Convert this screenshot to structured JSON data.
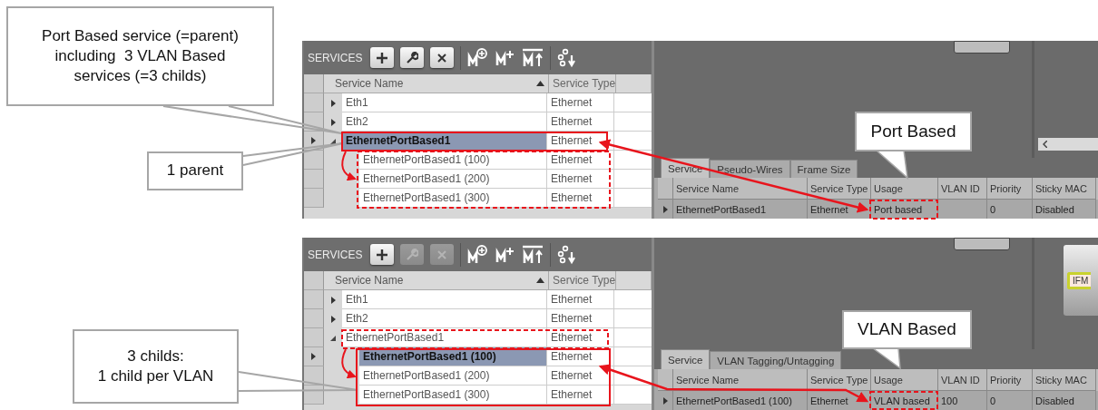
{
  "callouts": [
    {
      "text": "Port Based service (=parent)\nincluding  3 VLAN Based\nservices (=3 childs)"
    },
    {
      "text": "1 parent"
    },
    {
      "text": "3 childs:\n1 child per VLAN"
    },
    {
      "text": "Port Based"
    },
    {
      "text": "VLAN Based"
    }
  ],
  "panels": [
    {
      "toolbar": {
        "title": "SERVICES",
        "buttons": [
          {
            "kind": "add",
            "disabled": false
          },
          {
            "kind": "edit",
            "disabled": false
          },
          {
            "kind": "delete",
            "disabled": false
          },
          {
            "kind": "m-add",
            "disabled": false
          },
          {
            "kind": "m-plus",
            "disabled": false
          },
          {
            "kind": "m-up",
            "disabled": false
          },
          {
            "kind": "sort",
            "disabled": false
          }
        ]
      },
      "tree": {
        "columns": [
          {
            "label": "Service Name",
            "sorted": true
          },
          {
            "label": "Service Type"
          }
        ],
        "rows": [
          {
            "name": "Eth1",
            "type": "Ethernet",
            "expanded": false,
            "selected": false
          },
          {
            "name": "Eth2",
            "type": "Ethernet",
            "expanded": false,
            "selected": false
          },
          {
            "name": "EthernetPortBased1",
            "type": "Ethernet",
            "expanded": true,
            "selected": true,
            "children": [
              {
                "name": "EthernetPortBased1 (100)",
                "type": "Ethernet",
                "selected": false
              },
              {
                "name": "EthernetPortBased1 (200)",
                "type": "Ethernet",
                "selected": false
              },
              {
                "name": "EthernetPortBased1 (300)",
                "type": "Ethernet",
                "selected": false
              }
            ]
          }
        ]
      },
      "canvas": {
        "scrollbar": true
      },
      "tabs": [
        {
          "label": "Service",
          "selected": true
        },
        {
          "label": "Pseudo-Wires",
          "selected": false
        },
        {
          "label": "Frame Size",
          "selected": false
        }
      ],
      "details": {
        "columns": [
          "Service Name",
          "Service Type",
          "Usage",
          "VLAN ID",
          "Priority",
          "Sticky MAC"
        ],
        "rows": [
          [
            "EthernetPortBased1",
            "Ethernet",
            "Port based",
            null,
            "0",
            "Disabled"
          ]
        ]
      }
    },
    {
      "toolbar": {
        "title": "SERVICES",
        "buttons": [
          {
            "kind": "add",
            "disabled": false
          },
          {
            "kind": "edit",
            "disabled": true
          },
          {
            "kind": "delete",
            "disabled": true
          },
          {
            "kind": "m-add",
            "disabled": false
          },
          {
            "kind": "m-plus",
            "disabled": false
          },
          {
            "kind": "m-up",
            "disabled": false
          },
          {
            "kind": "sort",
            "disabled": false
          }
        ]
      },
      "tree": {
        "columns": [
          {
            "label": "Service Name",
            "sorted": true
          },
          {
            "label": "Service Type"
          }
        ],
        "rows": [
          {
            "name": "Eth1",
            "type": "Ethernet",
            "expanded": false,
            "selected": false
          },
          {
            "name": "Eth2",
            "type": "Ethernet",
            "expanded": false,
            "selected": false
          },
          {
            "name": "EthernetPortBased1",
            "type": "Ethernet",
            "expanded": true,
            "selected": false,
            "children": [
              {
                "name": "EthernetPortBased1 (100)",
                "type": "Ethernet",
                "selected": true
              },
              {
                "name": "EthernetPortBased1 (200)",
                "type": "Ethernet",
                "selected": false
              },
              {
                "name": "EthernetPortBased1 (300)",
                "type": "Ethernet",
                "selected": false
              }
            ]
          }
        ]
      },
      "canvas": {
        "scrollbar": false,
        "device_label": "IFM"
      },
      "tabs": [
        {
          "label": "Service",
          "selected": true
        },
        {
          "label": "VLAN Tagging/Untagging",
          "selected": false
        }
      ],
      "details": {
        "columns": [
          "Service Name",
          "Service Type",
          "Usage",
          "VLAN ID",
          "Priority",
          "Sticky MAC"
        ],
        "rows": [
          [
            "EthernetPortBased1 (100)",
            "Ethernet",
            "VLAN based",
            "100",
            "0",
            "Disabled"
          ]
        ]
      }
    }
  ]
}
